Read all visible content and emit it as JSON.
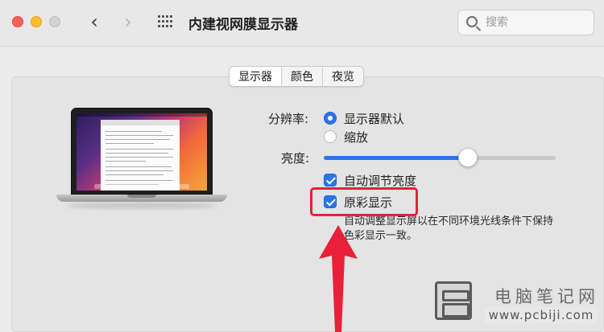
{
  "window": {
    "title": "内建视网膜显示器",
    "back_glyph": "‹",
    "forward_glyph": "›",
    "search_placeholder": "搜索"
  },
  "tabs": [
    {
      "label": "显示器",
      "selected": true
    },
    {
      "label": "颜色",
      "selected": false
    },
    {
      "label": "夜览",
      "selected": false
    }
  ],
  "display": {
    "resolution_label": "分辨率:",
    "resolution_options": [
      {
        "label": "显示器默认",
        "selected": true
      },
      {
        "label": "缩放",
        "selected": false
      }
    ],
    "brightness_label": "亮度:",
    "brightness_value": 0.62,
    "auto_brightness": {
      "label": "自动调节亮度",
      "checked": true
    },
    "true_tone": {
      "label": "原彩显示",
      "checked": true
    },
    "true_tone_description": "自动调整显示屏以在不同环境光线条件下保持色彩显示一致。"
  },
  "colors": {
    "accent": "#2a76e8",
    "annotation": "#e8203a"
  },
  "watermark": {
    "site_name": "电脑笔记网",
    "url": "www.pcbiji.com"
  }
}
